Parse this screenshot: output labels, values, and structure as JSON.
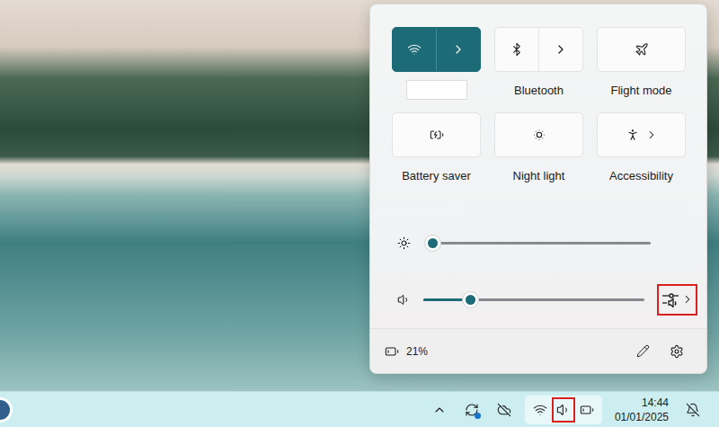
{
  "quick_settings": {
    "tiles": [
      {
        "label": "",
        "redacted": true,
        "kind": "split",
        "on": true
      },
      {
        "label": "Bluetooth",
        "redacted": false,
        "kind": "split",
        "on": false
      },
      {
        "label": "Flight mode",
        "redacted": false,
        "kind": "toggle",
        "on": false
      },
      {
        "label": "Battery saver",
        "redacted": false,
        "kind": "toggle",
        "on": false
      },
      {
        "label": "Night light",
        "redacted": false,
        "kind": "toggle",
        "on": false
      },
      {
        "label": "Accessibility",
        "redacted": false,
        "kind": "expand",
        "on": false
      }
    ],
    "sliders": [
      {
        "kind": "plain",
        "level": 0.0,
        "highlighted": false
      },
      {
        "kind": "mixer",
        "level": 0.21,
        "highlighted": true
      }
    ],
    "footer": {
      "battery": "21%"
    }
  },
  "taskbar": {
    "status_group": {
      "selected": true,
      "volume_highlighted": true
    },
    "clock": {
      "time": "14:44",
      "date": "01/01/2025"
    }
  }
}
